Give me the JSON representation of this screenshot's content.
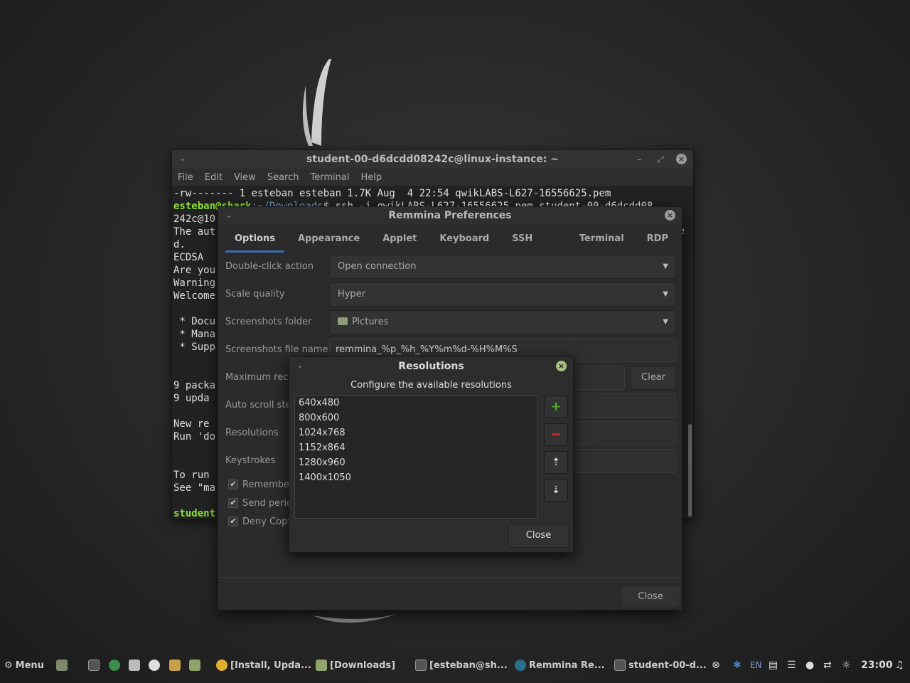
{
  "terminal": {
    "title": "student-00-d6dcdd08242c@linux-instance: ~",
    "menu": [
      "File",
      "Edit",
      "View",
      "Search",
      "Terminal",
      "Help"
    ],
    "lines": [
      "-rw------- 1 esteban esteban 1.7K Aug  4 22:54 qwikLABS-L627-16556625.pem",
      "",
      "242c@10",
      "The aut",
      "d.",
      "ECDSA ",
      "Are you",
      "Warning",
      "Welcome",
      "",
      " * Docu",
      " * Mana",
      " * Supp",
      "",
      "",
      "9 packa",
      "9 upda",
      "",
      "New re",
      "Run 'do",
      "",
      "",
      "To run",
      "See \"ma",
      "",
      ""
    ],
    "prompt_line": {
      "user": "esteban@shark",
      "path": ":~/Downloads",
      "cmd": "$ ssh -i qwikLABS-L627-16556625.pem student-00-d6dcdd08"
    },
    "trailing_e": "e",
    "last_prompt": "student"
  },
  "prefs": {
    "title": "Remmina Preferences",
    "tabs": [
      "Options",
      "Appearance",
      "Applet",
      "Keyboard",
      "SSH Options",
      "Terminal",
      "RDP"
    ],
    "active_tab": "Options",
    "double_click_label": "Double-click action",
    "double_click_value": "Open connection",
    "scale_label": "Scale quality",
    "scale_value": "Hyper",
    "folder_label": "Screenshots folder",
    "folder_value": "Pictures",
    "filename_label": "Screenshots file name",
    "filename_value": "remmina_%p_%h_%Y%m%d-%H%M%S",
    "max_recent_label": "Maximum rece",
    "clear_label": "Clear",
    "autoscroll_label": "Auto scroll step",
    "resolutions_label": "Resolutions",
    "keystrokes_label": "Keystrokes",
    "check_remember": "Remember",
    "check_send": "Send perio",
    "check_deny": "Deny Copy",
    "close_label": "Close"
  },
  "resolutions": {
    "title": "Resolutions",
    "subtitle": "Configure the available resolutions",
    "items": [
      "640x480",
      "800x600",
      "1024x768",
      "1152x864",
      "1280x960",
      "1400x1050"
    ],
    "close_label": "Close",
    "add_color": "#4caf2a",
    "remove_color": "#e03030"
  },
  "taskbar": {
    "menu_label": "Menu",
    "windows": [
      "[Install, Upda...",
      "[Downloads]",
      "[esteban@sh...",
      "Remmina Re...",
      "student-00-d..."
    ],
    "lang": "EN",
    "clock": "23:00"
  }
}
